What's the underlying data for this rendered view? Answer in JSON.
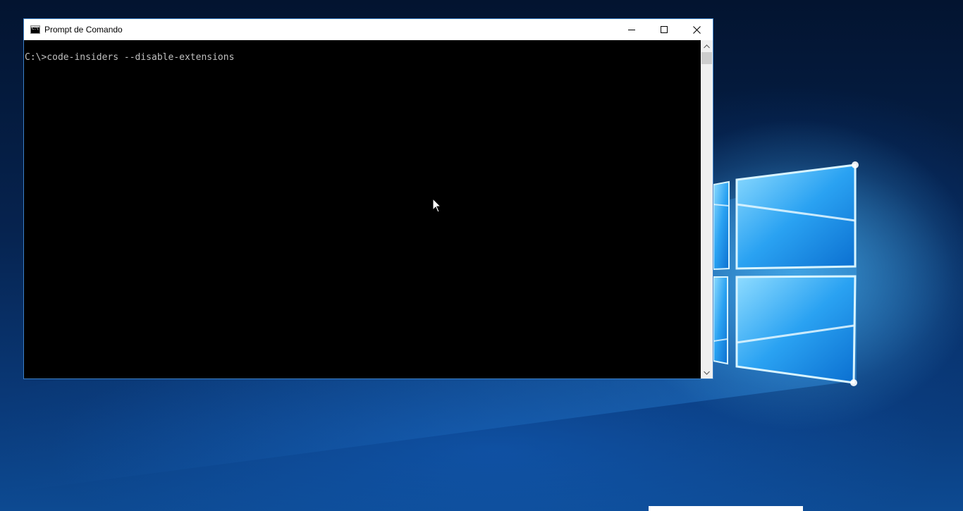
{
  "window": {
    "title": "Prompt de Comando",
    "icon": "cmd-icon",
    "icon_glyph": "C:\\",
    "accent_border": "#3b80c8",
    "controls": {
      "minimize_icon": "minimize-icon",
      "maximize_icon": "maximize-icon",
      "close_icon": "close-icon"
    }
  },
  "console": {
    "lines": [
      "C:\\>code-insiders --disable-extensions"
    ],
    "background": "#000000",
    "foreground": "#c0c0c0"
  },
  "scrollbar": {
    "up_icon": "chevron-up-icon",
    "down_icon": "chevron-down-icon"
  },
  "desktop": {
    "wallpaper": "windows-10-logo-wallpaper",
    "colors": {
      "deep": "#031430",
      "glow": "#4fc3ff"
    }
  }
}
